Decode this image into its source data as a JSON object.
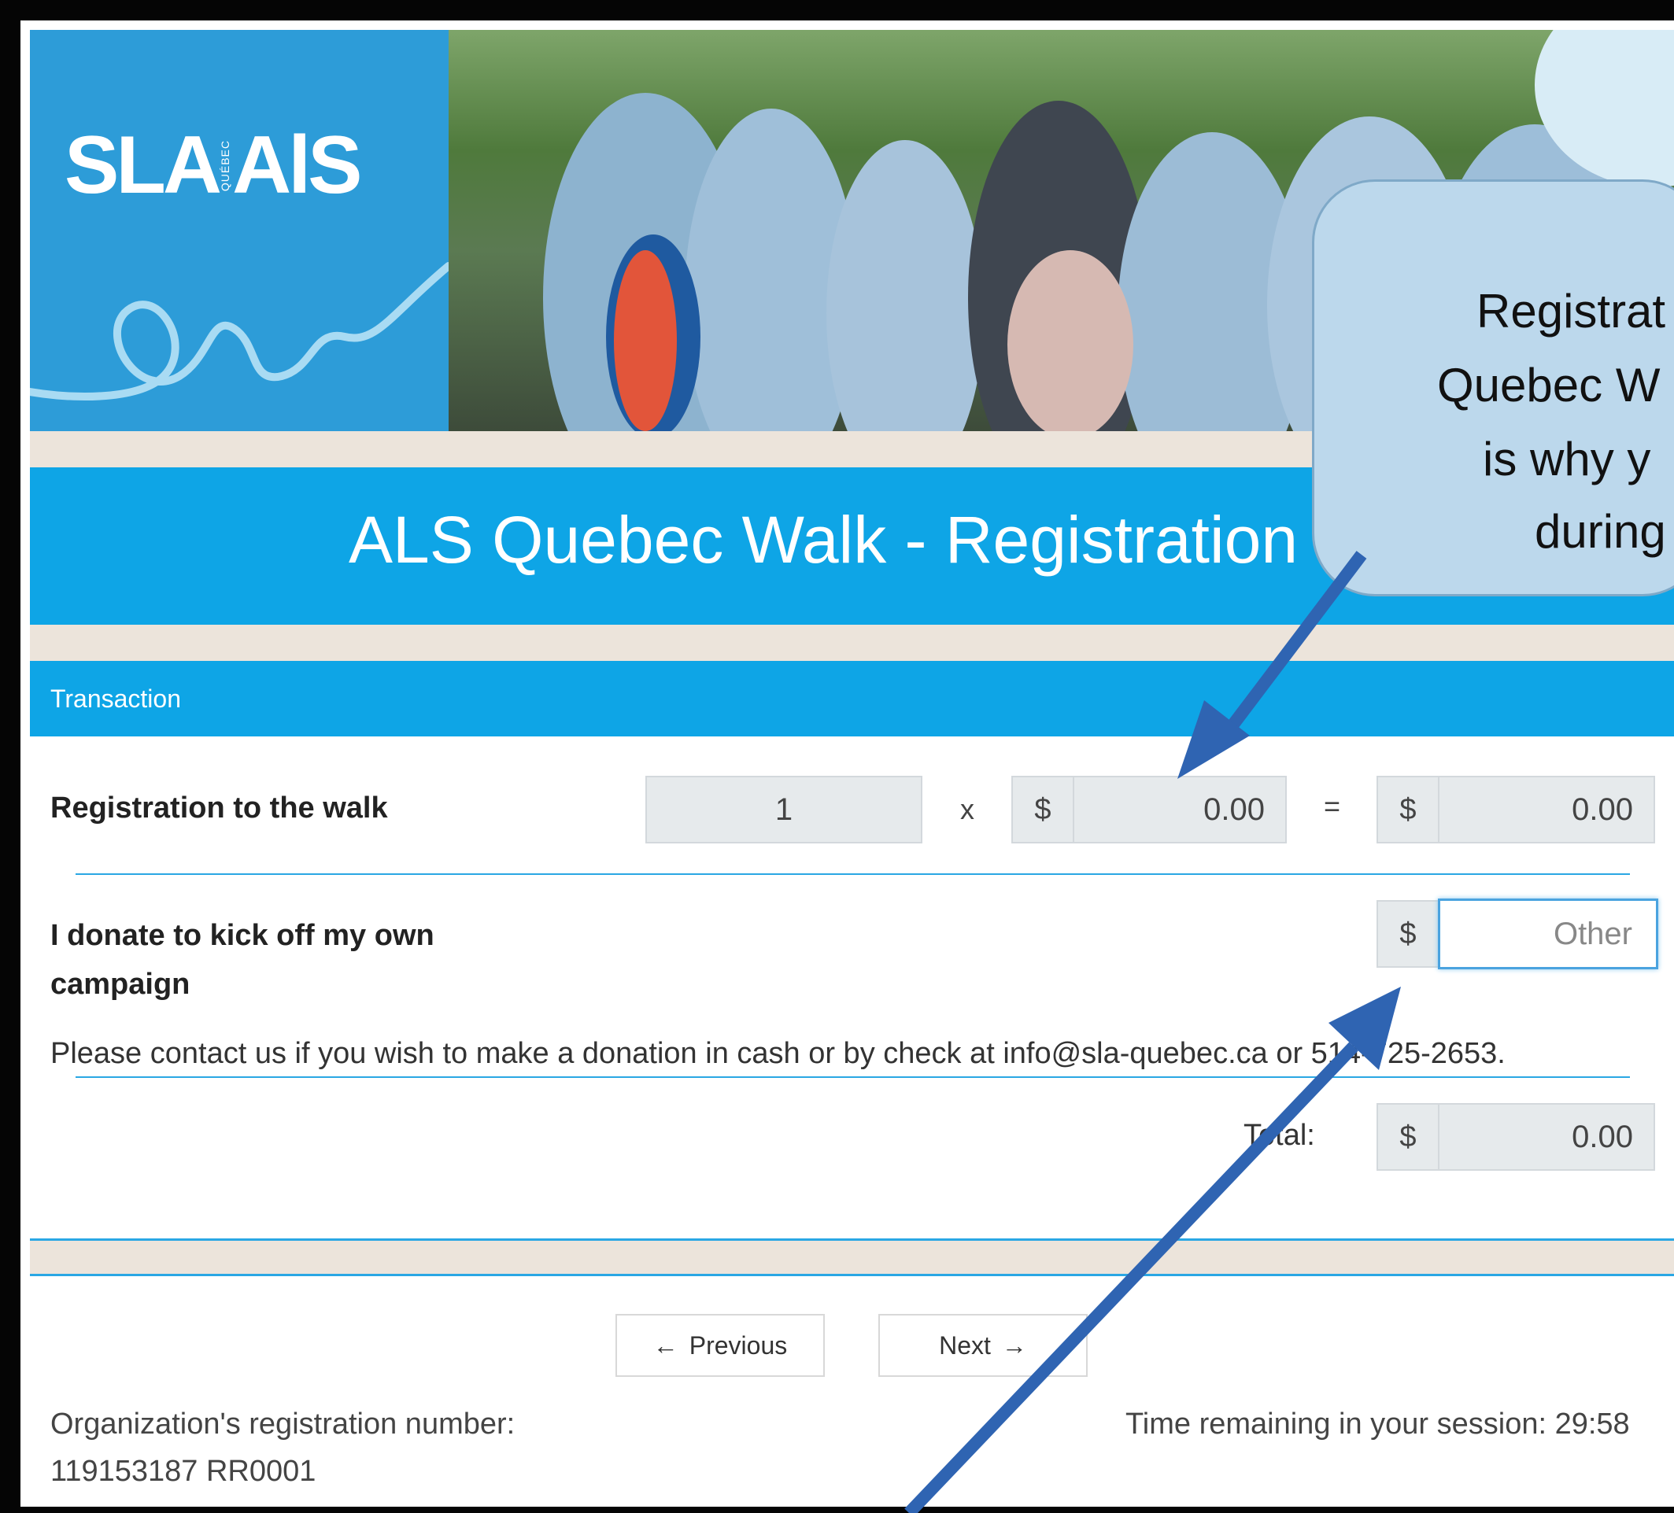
{
  "header": {
    "logo_text": "SLA AlS",
    "logo_small": "QUÉBEC",
    "page_title": "ALS Quebec Walk - Registration"
  },
  "section": {
    "label": "Transaction"
  },
  "registration": {
    "label": "Registration to the walk",
    "quantity": "1",
    "multiply": "x",
    "currency": "$",
    "unit_price": "0.00",
    "equals": "=",
    "subtotal": "0.00"
  },
  "donation": {
    "label_line1": "I donate to kick off my own",
    "label_line2": "campaign",
    "currency": "$",
    "placeholder": "Other",
    "note": "Please contact us if you wish to make a donation in cash or by check at info@sla-quebec.ca or 514-725-2653."
  },
  "total": {
    "label": "Total:",
    "currency": "$",
    "value": "0.00"
  },
  "nav": {
    "previous_label": "Previous",
    "next_label": "Next"
  },
  "footer": {
    "reg_label": "Organization's registration number:",
    "reg_number": "119153187 RR0001",
    "session": "Time remaining in your session: 29:58"
  },
  "callout": {
    "lines": [
      "Registrat",
      "Quebec W",
      "is why y",
      "during"
    ]
  },
  "colors": {
    "brand_blue": "#0ea5e6",
    "logo_blue": "#2d9cd8",
    "beige": "#ece4db",
    "arrow": "#2f64b2"
  }
}
